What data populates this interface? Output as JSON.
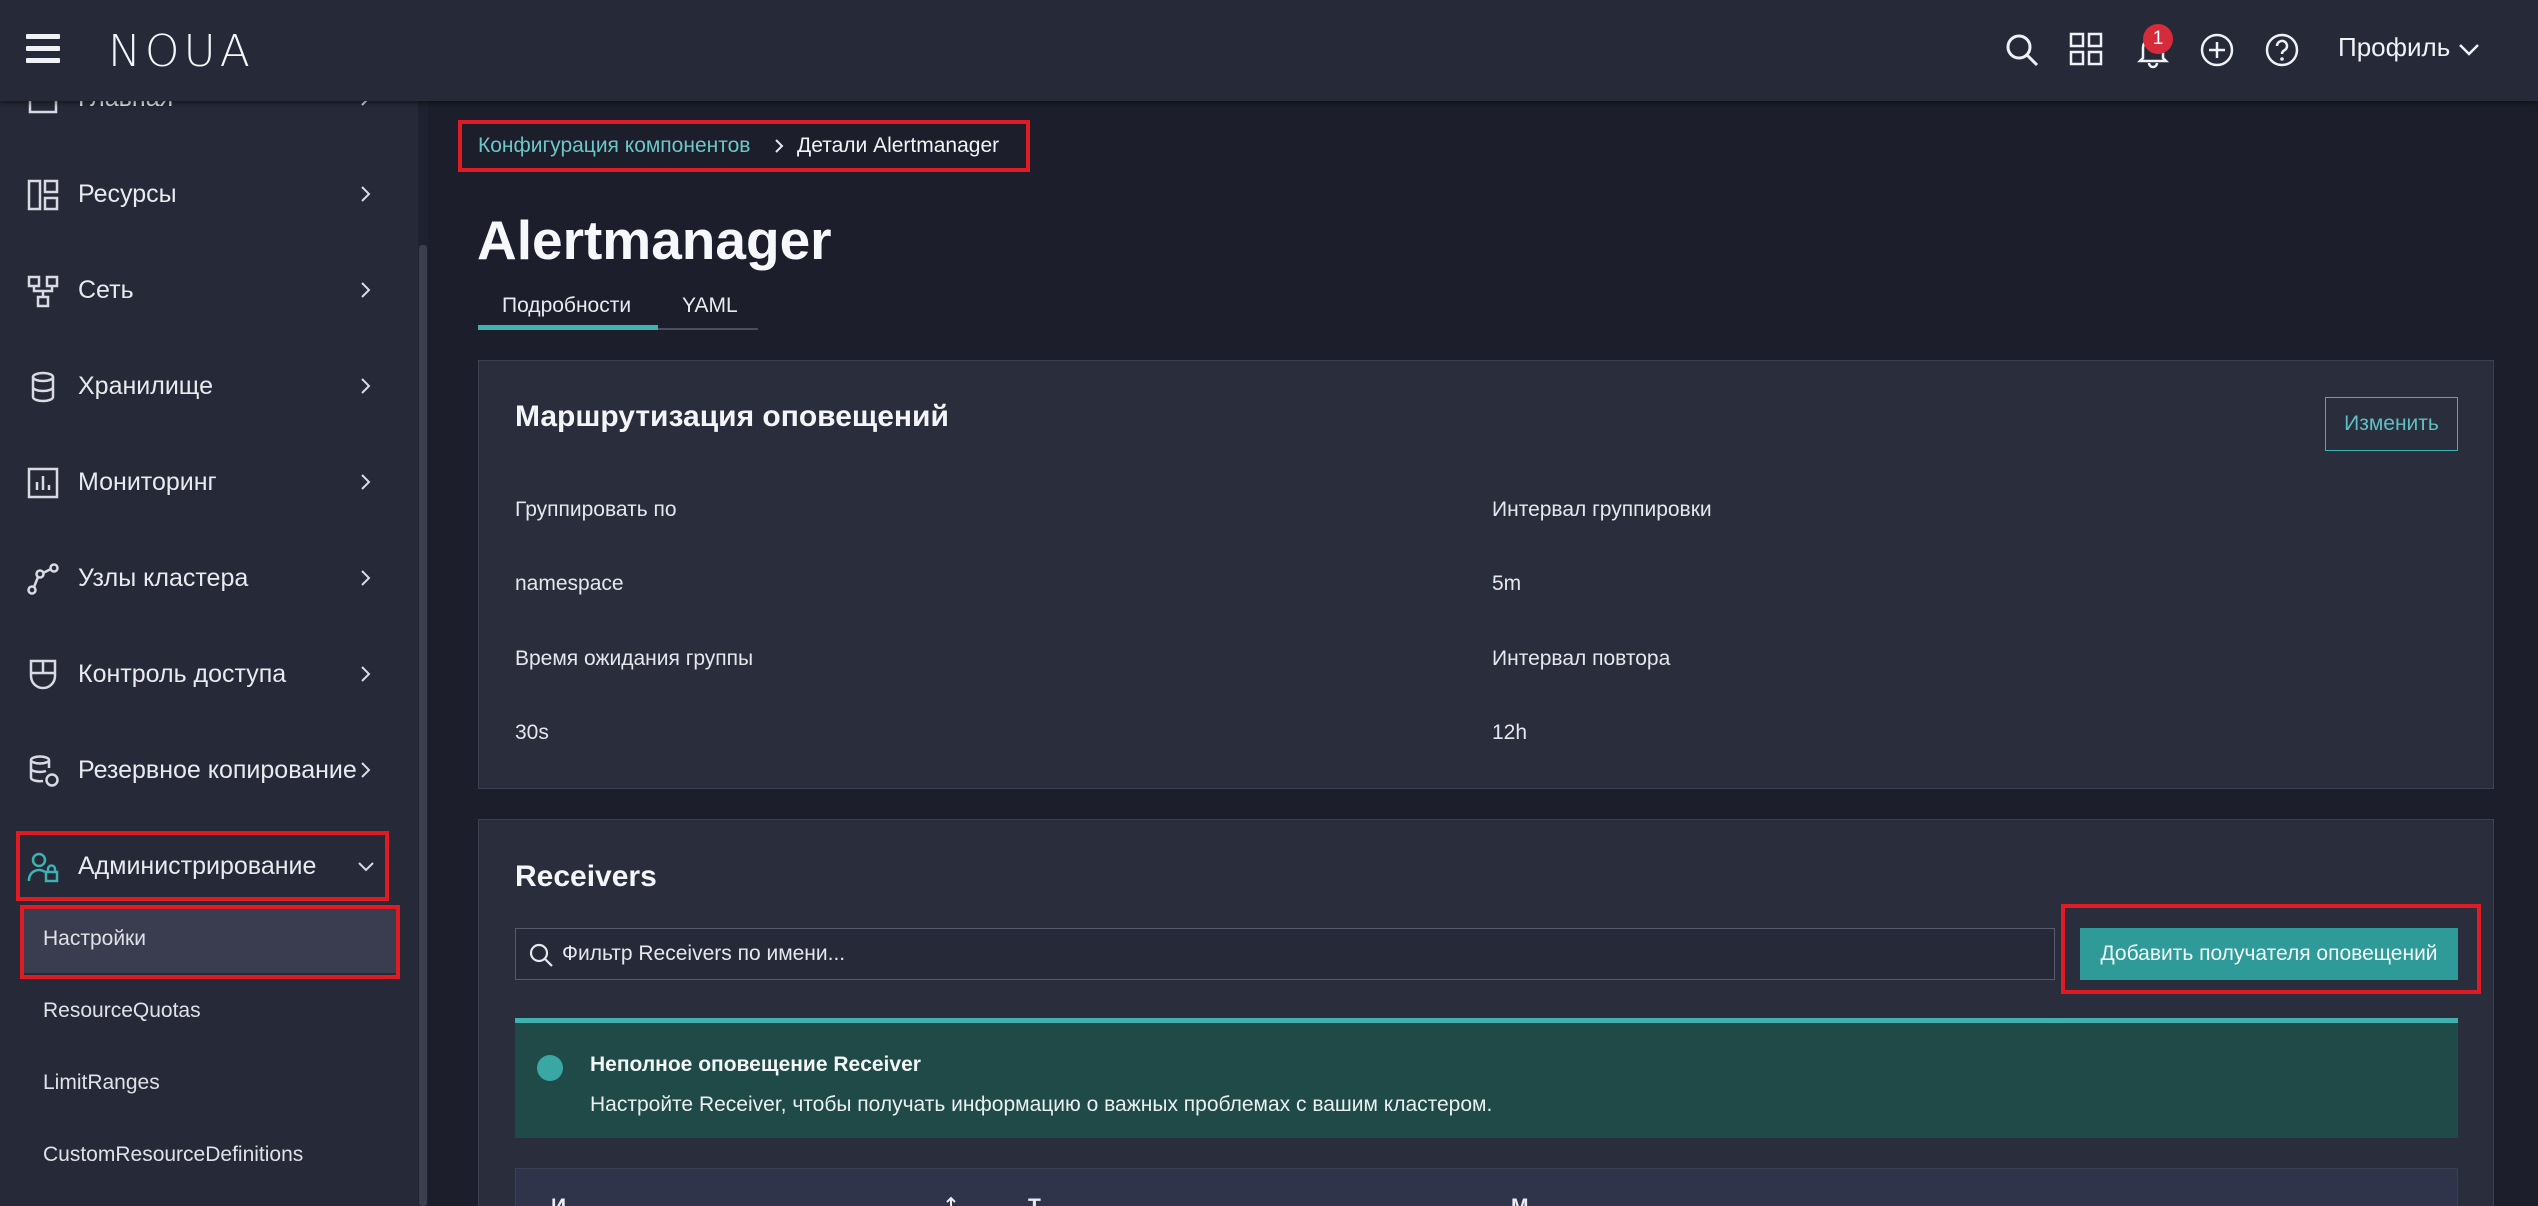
{
  "header": {
    "logo": "NOUA",
    "notification_count": "1",
    "profile_label": "Профиль"
  },
  "sidebar": {
    "items": [
      {
        "label": "Главная",
        "icon": "home-icon"
      },
      {
        "label": "Ресурсы",
        "icon": "grid-icon"
      },
      {
        "label": "Сеть",
        "icon": "network-icon"
      },
      {
        "label": "Хранилище",
        "icon": "database-icon"
      },
      {
        "label": "Мониторинг",
        "icon": "chart-icon"
      },
      {
        "label": "Узлы кластера",
        "icon": "nodes-icon"
      },
      {
        "label": "Контроль доступа",
        "icon": "shield-icon"
      },
      {
        "label": "Резервное копирование",
        "icon": "backup-icon"
      },
      {
        "label": "Администрирование",
        "icon": "admin-user-icon"
      }
    ],
    "subitems": [
      {
        "label": "Настройки"
      },
      {
        "label": "ResourceQuotas"
      },
      {
        "label": "LimitRanges"
      },
      {
        "label": "CustomResourceDefinitions"
      }
    ]
  },
  "breadcrumb": {
    "parent": "Конфигурация компонентов",
    "current": "Детали Alertmanager"
  },
  "page": {
    "title": "Alertmanager",
    "tabs": [
      {
        "label": "Подробности"
      },
      {
        "label": "YAML"
      }
    ]
  },
  "routing": {
    "title": "Маршрутизация оповещений",
    "edit_label": "Изменить",
    "group_by_label": "Группировать по",
    "group_by_value": "namespace",
    "group_interval_label": "Интервал группировки",
    "group_interval_value": "5m",
    "group_wait_label": "Время ожидания группы",
    "group_wait_value": "30s",
    "repeat_interval_label": "Интервал повтора",
    "repeat_interval_value": "12h"
  },
  "receivers": {
    "title": "Receivers",
    "filter_placeholder": "Фильтр Receivers по имени...",
    "add_label": "Добавить получателя оповещений",
    "alert_title": "Неполное оповещение Receiver",
    "alert_text": "Настройте Receiver, чтобы получать информацию о важных проблемах с вашим кластером.",
    "columns": [
      "И",
      "Т",
      "М"
    ]
  },
  "colors": {
    "accent": "#3eb1b1",
    "highlight": "#e01b24",
    "badge": "#d62b3b"
  }
}
